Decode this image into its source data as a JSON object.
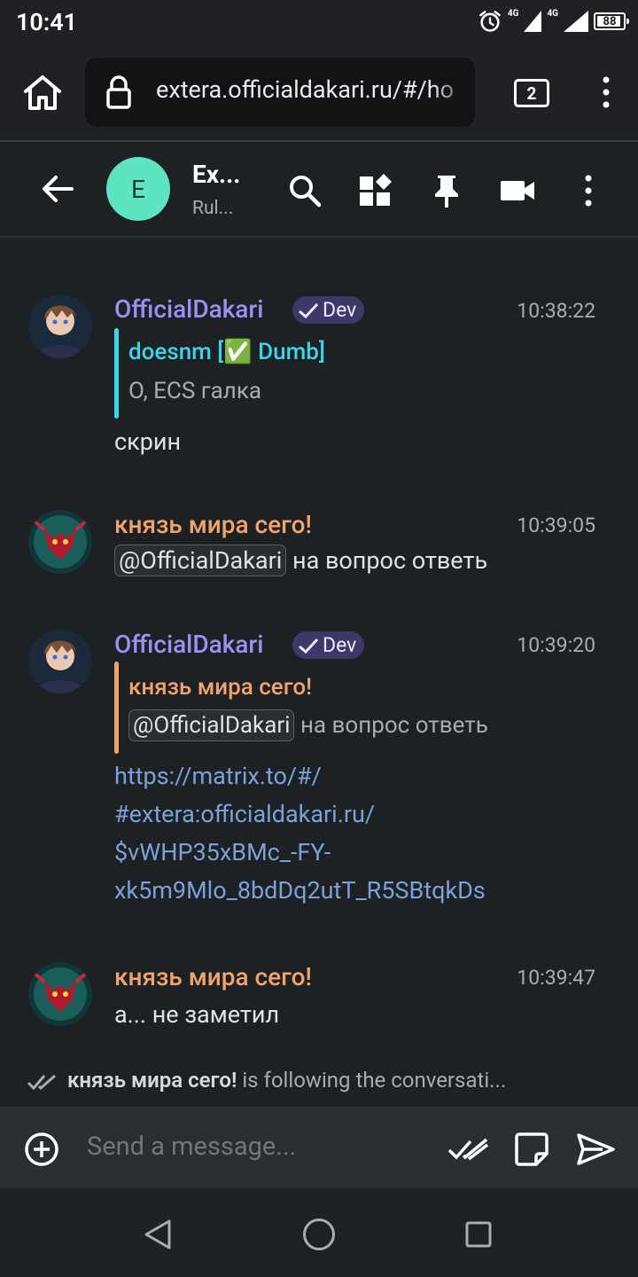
{
  "status_bar": {
    "time": "10:41",
    "network_1": "4G",
    "network_2": "4G",
    "battery": "88"
  },
  "browser": {
    "url": "extera.officialdakari.ru/#/ho",
    "tab_count": "2"
  },
  "room": {
    "avatar_letter": "E",
    "name": "Ex...",
    "topic": "Rul..."
  },
  "timeline": {
    "cut_off_text": "      ",
    "messages": [
      {
        "sender": "OfficialDakari",
        "badge": "Dev",
        "time": "10:38:22",
        "reply_sender": "doesnm [✅ Dumb]",
        "reply_body": "О, ECS галка",
        "body": "скрин"
      },
      {
        "sender": "князь мира сего!",
        "time": "10:39:05",
        "mention": "@OfficialDakari",
        "body": "на вопрос ответь"
      },
      {
        "sender": "OfficialDakari",
        "badge": "Dev",
        "time": "10:39:20",
        "reply_sender": "князь мира сего!",
        "reply_mention": "@OfficialDakari",
        "reply_body": "на вопрос ответь",
        "link_lines": [
          "https://matrix.to/#/",
          "#extera:officialdakari.ru/",
          "$vWHP35xBMc_-FY-",
          "xk5m9Mlo_8bdDq2utT_R5SBtqkDs"
        ]
      },
      {
        "sender": "князь мира сего!",
        "time": "10:39:47",
        "body": "а... не заметил"
      }
    ],
    "following_name": "князь мира сего!",
    "following_text": " is following the conversati..."
  },
  "composer": {
    "placeholder": "Send a message..."
  },
  "colors": {
    "dev_color": "#9d90f5",
    "prince_color": "#f0a36b",
    "reply_cyan": "#3ad6e8",
    "link": "#7aa2d8",
    "room_avatar": "#5ee4c0"
  }
}
